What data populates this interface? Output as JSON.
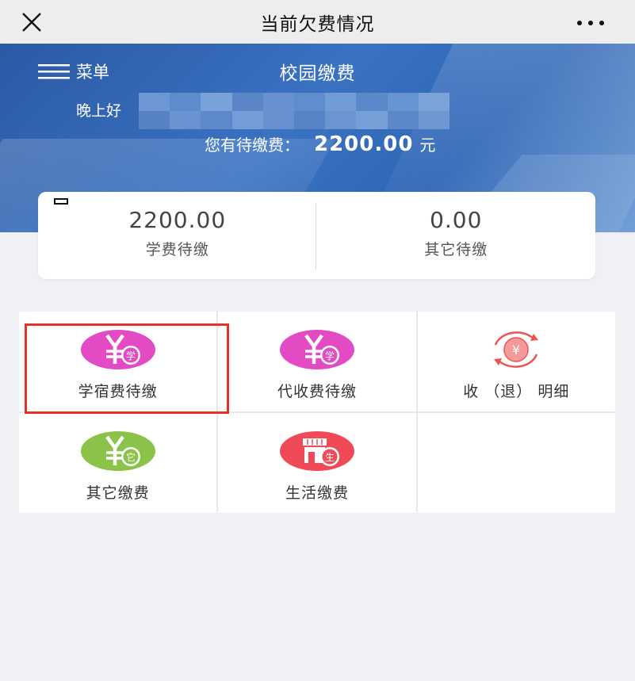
{
  "topbar": {
    "title": "当前欠费情况"
  },
  "hero": {
    "menu_label": "菜单",
    "title": "校园缴费",
    "greeting": "晚上好",
    "due_prefix": "您有待缴费：",
    "due_amount": "2200.00",
    "due_unit": "元"
  },
  "summary": [
    {
      "amount": "2200.00",
      "label": "学费待缴"
    },
    {
      "amount": "0.00",
      "label": "其它待缴"
    }
  ],
  "services": [
    {
      "label": "学宿费待缴",
      "icon": "yuan-xue-icon",
      "color": "#e34bc4",
      "badge": "学"
    },
    {
      "label": "代收费待缴",
      "icon": "yuan-xue-icon",
      "color": "#e34bc4",
      "badge": "学"
    },
    {
      "label": "收 （退） 明细",
      "icon": "refund-cycle-icon",
      "color": "#ef5350",
      "badge": "¥"
    },
    {
      "label": "其它缴费",
      "icon": "yuan-ta-icon",
      "color": "#8bc34a",
      "badge": "它"
    },
    {
      "label": "生活缴费",
      "icon": "store-life-icon",
      "color": "#ef4a55",
      "badge": "生"
    }
  ],
  "colors": {
    "brand_blue": "#3a72c2",
    "highlight_red": "#e8302a"
  }
}
